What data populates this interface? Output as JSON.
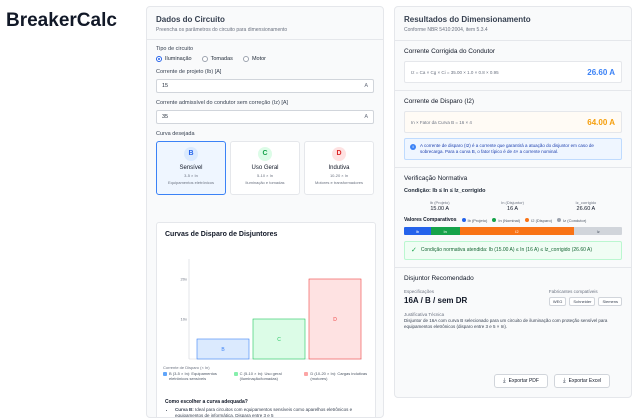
{
  "app": {
    "brand": "BreakerCalc"
  },
  "left": {
    "title": "Dados do Circuito",
    "subtitle": "Preencha os parâmetros do circuito para dimensionamento",
    "circuit_type": {
      "label": "Tipo de circuito",
      "options": [
        "Iluminação",
        "Tomadas",
        "Motor"
      ],
      "selected": "Iluminação"
    },
    "ib": {
      "label": "Corrente de projeto (Ib) [A]",
      "value": "15",
      "unit": "A"
    },
    "iz": {
      "label": "Corrente admissível do condutor sem correção (Iz) [A]",
      "value": "35",
      "unit": "A"
    },
    "curve": {
      "label": "Curva desejada",
      "cards": [
        {
          "letter": "B",
          "name": "Sensível",
          "range": "3-5 × In",
          "use": "Equipamentos eletrônicos",
          "color": "#2563eb",
          "bg": "#dbeafe"
        },
        {
          "letter": "C",
          "name": "Uso Geral",
          "range": "5-10 × In",
          "use": "Iluminação e tomadas",
          "color": "#16a34a",
          "bg": "#dcfce7"
        },
        {
          "letter": "D",
          "name": "Indutiva",
          "range": "10-20 × In",
          "use": "Motores e transformadores",
          "color": "#dc2626",
          "bg": "#fee2e2"
        }
      ],
      "selected": "B"
    }
  },
  "chart": {
    "title": "Curvas de Disparo de Disjuntores",
    "xlabel": "Corrente de Disparo (× In)",
    "legend": [
      {
        "text": "B (3-5 × In): Equipamentos eletrônicos sensíveis",
        "color": "#60a5fa"
      },
      {
        "text": "C (5-10 × In): Uso geral (iluminação/tomadas)",
        "color": "#86efac"
      },
      {
        "text": "D (10-20 × In): Cargas indutivas (motores)",
        "color": "#fca5a5"
      }
    ],
    "how_q": "Como escolher a curva adequada?",
    "how_b_lead": "Curva B:",
    "how_b": " Ideal para circuitos com equipamentos sensíveis como aparelhos eletrônicos e equipamentos de informática. Dispara entre 3 e 5"
  },
  "chart_data": {
    "type": "bar",
    "categories": [
      "B",
      "C",
      "D"
    ],
    "series": [
      {
        "values": [
          3,
          5,
          10
        ],
        "range_end": [
          5,
          10,
          20
        ]
      }
    ],
    "yticks": [
      "10x",
      "20x"
    ],
    "ylim": [
      0,
      25
    ],
    "colors": {
      "B": "#dbeafe",
      "C": "#dcfce7",
      "D": "#fee2e2"
    },
    "strokes": {
      "B": "#3b82f6",
      "C": "#22c55e",
      "D": "#ef4444"
    }
  },
  "right": {
    "title": "Resultados do Dimensionamento",
    "subtitle": "Conforme NBR 5410:2004, item 5.3.4",
    "corrected": {
      "title": "Corrente Corrigida do Condutor",
      "formula": "Iz = Ca × Cg × Ci  =  35.00 × 1.0 × 0.8 × 0.95",
      "value": "26.60 A",
      "color": "#3b82f6"
    },
    "trip": {
      "title": "Corrente de Disparo (I2)",
      "formula": "In × Fator da Curva B  =  16 × 4",
      "value": "64.00 A",
      "color": "#f59e0b",
      "info": "A corrente de disparo (I2) é a corrente que garantirá a atuação do disjuntor em caso de sobrecarga. Para a curva B, o fator típico é de 4× a corrente nominal."
    },
    "verify": {
      "title": "Verificação Normativa",
      "condition": "Condição: Ib ≤ In ≤ Iz_corrigido",
      "cols": [
        {
          "h": "Ib (Projeto)",
          "v": "15.00 A"
        },
        {
          "h": "In (Disjuntor)",
          "v": "16 A"
        },
        {
          "h": "Iz_corrigido",
          "v": "26.60 A"
        }
      ],
      "cmp_label": "Valores Comparativos",
      "cmp_legend": [
        {
          "t": "Ib (Projeto)",
          "c": "#2563eb"
        },
        {
          "t": "In (Nominal)",
          "c": "#16a34a"
        },
        {
          "t": "I2 (Disparo)",
          "c": "#f97316"
        },
        {
          "t": "Iz (Condutor)",
          "c": "#9ca3af"
        }
      ],
      "bar": [
        {
          "t": "Ib",
          "c": "#2563eb",
          "v": 15
        },
        {
          "t": "In",
          "c": "#16a34a",
          "v": 16
        },
        {
          "t": "I2",
          "c": "#f97316",
          "v": 64
        },
        {
          "t": "Iz",
          "c": "#d1d5db",
          "v": 26.6
        }
      ],
      "ok": "Condição normativa atendida: Ib (15.00 A) ≤ In (16 A) ≤ Iz_corrigido (26.60 A)"
    },
    "breaker": {
      "title": "Disjuntor Recomendado",
      "spec_h": "Especificações",
      "spec_v": "16A / B / sem DR",
      "mfr_h": "Fabricantes compatíveis",
      "mfrs": [
        "WEG",
        "Schneider",
        "Siemens"
      ],
      "just_h": "Justificativa Técnica",
      "just": "Disjuntor de 16A com curva B selecionado para um circuito de iluminação com proteção sensível para equipamentos eletrônicos (disparo entre 3 e 5 × In)."
    },
    "buttons": [
      "Exportar PDF",
      "Exportar Excel"
    ]
  }
}
